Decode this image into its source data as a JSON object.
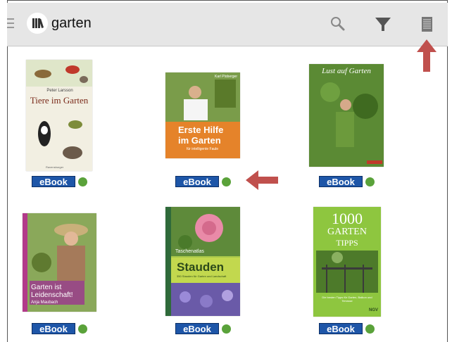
{
  "toolbar": {
    "query": "garten",
    "icons": [
      "menu-icon",
      "library-logo-icon",
      "search-icon",
      "filter-icon",
      "list-view-icon"
    ]
  },
  "books": [
    {
      "cover_author": "Peter Larsson",
      "cover_title": "Tiere im Garten",
      "cover_publisher": "Ravensburger",
      "badge": "eBook"
    },
    {
      "cover_author": "Karl Ploberger",
      "cover_title_1": "Erste Hilfe",
      "cover_title_2": "im Garten",
      "cover_subtitle": "für intelligente Faule",
      "badge": "eBook"
    },
    {
      "cover_title": "Lust auf Garten",
      "badge": "eBook"
    },
    {
      "cover_title_1": "Garten ist",
      "cover_title_2": "Leidenschaft!",
      "cover_author": "Anja Maubach",
      "badge": "eBook"
    },
    {
      "cover_kicker": "Taschenatlas",
      "cover_title": "Stauden",
      "cover_subtitle": "350 Stauden für Garten und Landschaft",
      "badge": "eBook"
    },
    {
      "cover_title_1": "1000",
      "cover_title_2": "GARTEN",
      "cover_title_3": "TIPPS",
      "cover_subtitle": "Die besten Tipps für Garten, Balkon und Terrasse",
      "cover_publisher": "NGV",
      "badge": "eBook"
    }
  ],
  "colors": {
    "badge": "#1e56a8",
    "available_dot": "#5aa23a",
    "annotation_arrow": "#c0504d",
    "toolbar": "#e6e6e6"
  }
}
